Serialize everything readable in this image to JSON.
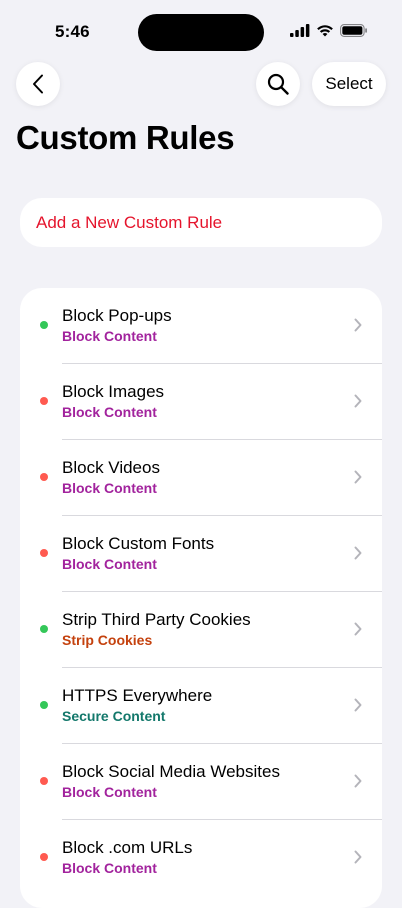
{
  "status_bar": {
    "time": "5:46"
  },
  "nav": {
    "select_label": "Select"
  },
  "page": {
    "title": "Custom Rules"
  },
  "add_rule": {
    "label": "Add a New Custom Rule"
  },
  "colors": {
    "accent_red": "#e5142c",
    "status_on": "#34c759",
    "status_off": "#ff5a50",
    "category_block": "#a2239d",
    "category_strip": "#c4410d",
    "category_secure": "#13786b"
  },
  "rules": [
    {
      "name": "Block Pop-ups",
      "category": "Block Content",
      "enabled": true,
      "category_color": "#a2239d"
    },
    {
      "name": "Block Images",
      "category": "Block Content",
      "enabled": false,
      "category_color": "#a2239d"
    },
    {
      "name": "Block Videos",
      "category": "Block Content",
      "enabled": false,
      "category_color": "#a2239d"
    },
    {
      "name": "Block Custom Fonts",
      "category": "Block Content",
      "enabled": false,
      "category_color": "#a2239d"
    },
    {
      "name": "Strip Third Party Cookies",
      "category": "Strip Cookies",
      "enabled": true,
      "category_color": "#c4410d"
    },
    {
      "name": "HTTPS Everywhere",
      "category": "Secure Content",
      "enabled": true,
      "category_color": "#13786b"
    },
    {
      "name": "Block Social Media Websites",
      "category": "Block Content",
      "enabled": false,
      "category_color": "#a2239d"
    },
    {
      "name": "Block .com URLs",
      "category": "Block Content",
      "enabled": false,
      "category_color": "#a2239d"
    }
  ],
  "icons": {
    "back": "chevron-left-icon",
    "search": "magnifying-glass-icon",
    "row_disclosure": "chevron-right-icon"
  }
}
